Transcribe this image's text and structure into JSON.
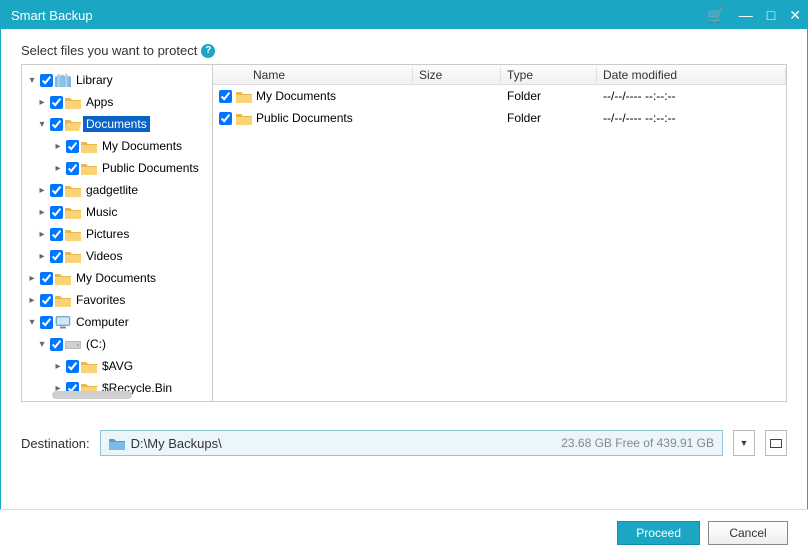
{
  "window": {
    "title": "Smart Backup"
  },
  "header": {
    "prompt": "Select files you want to protect"
  },
  "tree": [
    {
      "depth": 0,
      "arrow": "▾",
      "icon": "library",
      "label": "Library",
      "selected": false
    },
    {
      "depth": 1,
      "arrow": "▸",
      "icon": "folder",
      "label": "Apps",
      "selected": false
    },
    {
      "depth": 1,
      "arrow": "▾",
      "icon": "folder-open",
      "label": "Documents",
      "selected": true
    },
    {
      "depth": 2,
      "arrow": "▸",
      "icon": "folder",
      "label": "My Documents",
      "selected": false
    },
    {
      "depth": 2,
      "arrow": "▸",
      "icon": "folder",
      "label": "Public Documents",
      "selected": false
    },
    {
      "depth": 1,
      "arrow": "▸",
      "icon": "folder",
      "label": "gadgetlite",
      "selected": false
    },
    {
      "depth": 1,
      "arrow": "▸",
      "icon": "folder",
      "label": "Music",
      "selected": false
    },
    {
      "depth": 1,
      "arrow": "▸",
      "icon": "folder",
      "label": "Pictures",
      "selected": false
    },
    {
      "depth": 1,
      "arrow": "▸",
      "icon": "folder",
      "label": "Videos",
      "selected": false
    },
    {
      "depth": 0,
      "arrow": "▸",
      "icon": "folder",
      "label": "My Documents",
      "selected": false
    },
    {
      "depth": 0,
      "arrow": "▸",
      "icon": "folder",
      "label": "Favorites",
      "selected": false
    },
    {
      "depth": 0,
      "arrow": "▾",
      "icon": "computer",
      "label": "Computer",
      "selected": false
    },
    {
      "depth": 1,
      "arrow": "▾",
      "icon": "drive",
      "label": "(C:)",
      "selected": false
    },
    {
      "depth": 2,
      "arrow": "▸",
      "icon": "folder",
      "label": "$AVG",
      "selected": false
    },
    {
      "depth": 2,
      "arrow": "▸",
      "icon": "folder",
      "label": "$Recycle.Bin",
      "selected": false
    }
  ],
  "list": {
    "columns": {
      "name": "Name",
      "size": "Size",
      "type": "Type",
      "date": "Date modified"
    },
    "rows": [
      {
        "name": "My Documents",
        "size": "",
        "type": "Folder",
        "date": "--/--/---- --:--:--"
      },
      {
        "name": "Public Documents",
        "size": "",
        "type": "Folder",
        "date": "--/--/---- --:--:--"
      }
    ]
  },
  "destination": {
    "label": "Destination:",
    "path": "D:\\My Backups\\",
    "free": "23.68 GB Free of 439.91 GB"
  },
  "buttons": {
    "proceed": "Proceed",
    "cancel": "Cancel"
  }
}
